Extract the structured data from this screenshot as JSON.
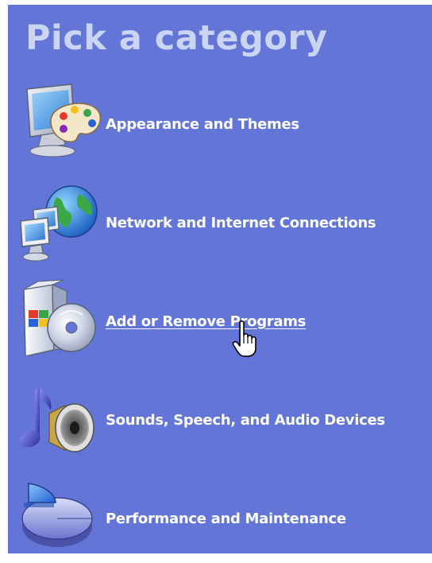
{
  "title": "Pick a category",
  "categories": [
    {
      "label": "Appearance and Themes",
      "icon": "appearance-themes-icon"
    },
    {
      "label": "Network and Internet Connections",
      "icon": "network-internet-icon"
    },
    {
      "label": "Add or Remove Programs",
      "icon": "add-remove-programs-icon",
      "state": "hover"
    },
    {
      "label": "Sounds, Speech, and Audio Devices",
      "icon": "sounds-audio-icon"
    },
    {
      "label": "Performance and Maintenance",
      "icon": "performance-maintenance-icon"
    }
  ],
  "colors": {
    "panel_background": "#6375d6",
    "title_text": "#c9d5f2",
    "label_text": "#ffffff"
  },
  "cursor": "hand-pointer-cursor"
}
